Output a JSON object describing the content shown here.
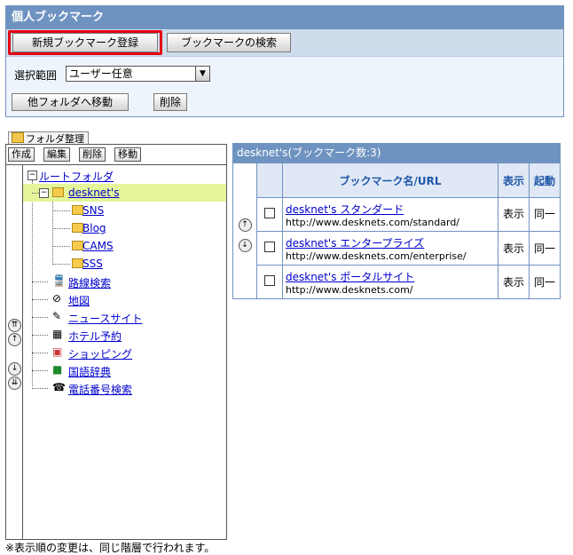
{
  "panel": {
    "title": "個人ブックマーク",
    "new_button": "新規ブックマーク登録",
    "search_button": "ブックマークの検索",
    "scope_label": "選択範囲",
    "scope_value": "ユーザー任意",
    "move_button": "他フォルダへ移動",
    "delete_button": "削除"
  },
  "folders": {
    "tab_label": "フォルダ整理",
    "create": "作成",
    "edit": "編集",
    "delete": "削除",
    "move": "移動",
    "root": "ルートフォルダ",
    "items": [
      {
        "label": "desknet's",
        "icon": "folder-icon"
      },
      {
        "label": "SNS",
        "icon": "folder-icon"
      },
      {
        "label": "Blog",
        "icon": "folder-icon"
      },
      {
        "label": "CAMS",
        "icon": "folder-icon"
      },
      {
        "label": "SSS",
        "icon": "folder-icon"
      },
      {
        "label": "路線検索",
        "icon": "train-icon"
      },
      {
        "label": "地図",
        "icon": "compass-icon"
      },
      {
        "label": "ニュースサイト",
        "icon": "news-icon"
      },
      {
        "label": "ホテル予約",
        "icon": "hotel-icon"
      },
      {
        "label": "ショッピング",
        "icon": "shopping-icon"
      },
      {
        "label": "国語辞典",
        "icon": "book-icon"
      },
      {
        "label": "電話番号検索",
        "icon": "phone-icon"
      }
    ],
    "note": "※表示順の変更は、同じ階層で行われます。"
  },
  "bookmarks": {
    "header": "desknet's(ブックマーク数:3)",
    "col_name": "ブックマーク名/URL",
    "col_show": "表示",
    "col_start": "起動",
    "rows": [
      {
        "name": "desknet's スタンダード",
        "url": "http://www.desknets.com/standard/",
        "show": "表示",
        "start": "同一"
      },
      {
        "name": "desknet's エンタープライズ",
        "url": "http://www.desknets.com/enterprise/",
        "show": "表示",
        "start": "同一"
      },
      {
        "name": "desknet's ポータルサイト",
        "url": "http://www.desknets.com/",
        "show": "表示",
        "start": "同一"
      }
    ]
  }
}
